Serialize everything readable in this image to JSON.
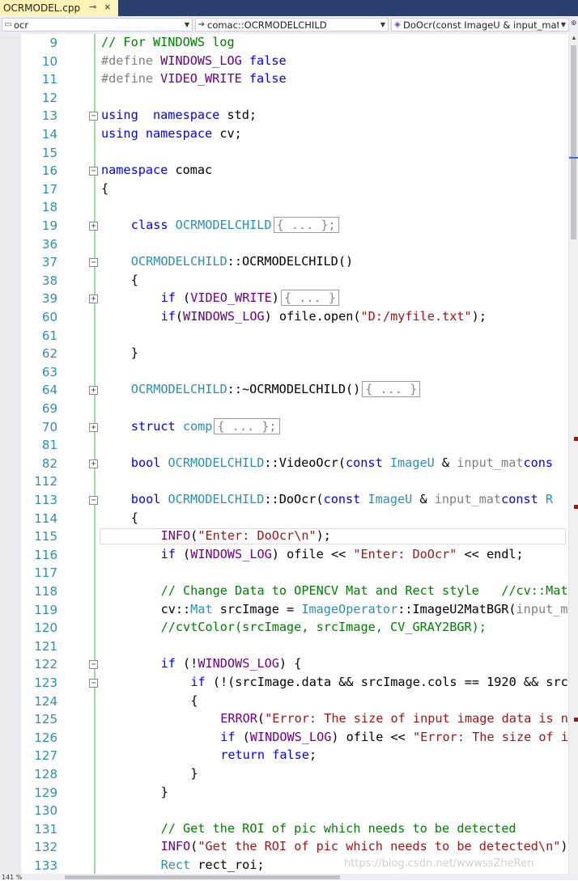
{
  "tab": {
    "title": "OCRMODEL.cpp",
    "pin": "⊸",
    "close": "×"
  },
  "navbar": {
    "scope": {
      "icon": "file-icon",
      "text": "ocr"
    },
    "class": {
      "icon": "arrow-right-icon",
      "text": "comac::OCRMODELCHILD"
    },
    "function": {
      "icon": "method-icon",
      "text": "DoOcr(const ImageU & input_mat,"
    }
  },
  "zoom": "141 %",
  "watermark": "https://blog.csdn.net/wwwssZheRen",
  "lines": [
    {
      "n": "9",
      "fold": "",
      "indent": 0,
      "tokens": [
        [
          "cm",
          "// For WINDOWS log"
        ]
      ]
    },
    {
      "n": "10",
      "fold": "",
      "indent": 0,
      "tokens": [
        [
          "pp",
          "#define "
        ],
        [
          "mac",
          "WINDOWS_LOG"
        ],
        [
          "pp",
          " "
        ],
        [
          "kw",
          "false"
        ]
      ]
    },
    {
      "n": "11",
      "fold": "",
      "indent": 0,
      "tokens": [
        [
          "pp",
          "#define "
        ],
        [
          "mac",
          "VIDEO_WRITE"
        ],
        [
          "pp",
          " "
        ],
        [
          "kw",
          "false"
        ]
      ]
    },
    {
      "n": "12",
      "fold": "",
      "indent": 0,
      "tokens": []
    },
    {
      "n": "13",
      "fold": "−",
      "indent": 0,
      "tokens": [
        [
          "kw",
          "using"
        ],
        [
          "",
          "  "
        ],
        [
          "kw",
          "namespace"
        ],
        [
          "",
          " std;"
        ]
      ]
    },
    {
      "n": "14",
      "fold": "",
      "indent": 0,
      "tokens": [
        [
          "kw",
          "using"
        ],
        [
          "",
          " "
        ],
        [
          "kw",
          "namespace"
        ],
        [
          "",
          " cv;"
        ]
      ]
    },
    {
      "n": "15",
      "fold": "",
      "indent": 0,
      "tokens": []
    },
    {
      "n": "16",
      "fold": "−",
      "indent": 0,
      "tokens": [
        [
          "kw",
          "namespace"
        ],
        [
          "",
          " comac"
        ]
      ]
    },
    {
      "n": "17",
      "fold": "",
      "indent": 0,
      "tokens": [
        [
          "",
          "{"
        ]
      ]
    },
    {
      "n": "18",
      "fold": "",
      "indent": 0,
      "tokens": []
    },
    {
      "n": "19",
      "fold": "+",
      "indent": 1,
      "tokens": [
        [
          "kw",
          "class"
        ],
        [
          "",
          " "
        ],
        [
          "cls",
          "OCRMODELCHILD"
        ],
        [
          "box",
          "{ ... };"
        ]
      ]
    },
    {
      "n": "36",
      "fold": "",
      "indent": 0,
      "tokens": []
    },
    {
      "n": "37",
      "fold": "−",
      "indent": 1,
      "tokens": [
        [
          "cls",
          "OCRMODELCHILD"
        ],
        [
          "",
          "::OCRMODELCHILD()"
        ]
      ]
    },
    {
      "n": "38",
      "fold": "",
      "indent": 1,
      "tokens": [
        [
          "",
          "{"
        ]
      ]
    },
    {
      "n": "39",
      "fold": "+",
      "indent": 2,
      "tokens": [
        [
          "kw",
          "if"
        ],
        [
          "",
          " ("
        ],
        [
          "mac",
          "VIDEO_WRITE"
        ],
        [
          "",
          ")"
        ],
        [
          "box",
          "{ ... }"
        ]
      ]
    },
    {
      "n": "60",
      "fold": "",
      "indent": 2,
      "tokens": [
        [
          "kw",
          "if"
        ],
        [
          "",
          "("
        ],
        [
          "mac",
          "WINDOWS_LOG"
        ],
        [
          "",
          ") ofile.open("
        ],
        [
          "str",
          "\"D:/myfile.txt\""
        ],
        [
          "",
          ");"
        ]
      ]
    },
    {
      "n": "61",
      "fold": "",
      "indent": 0,
      "tokens": []
    },
    {
      "n": "62",
      "fold": "",
      "indent": 1,
      "tokens": [
        [
          "",
          "}"
        ]
      ]
    },
    {
      "n": "63",
      "fold": "",
      "indent": 0,
      "tokens": []
    },
    {
      "n": "64",
      "fold": "+",
      "indent": 1,
      "tokens": [
        [
          "cls",
          "OCRMODELCHILD"
        ],
        [
          "",
          "::~OCRMODELCHILD()"
        ],
        [
          "box",
          "{ ... }"
        ]
      ]
    },
    {
      "n": "69",
      "fold": "",
      "indent": 0,
      "tokens": []
    },
    {
      "n": "70",
      "fold": "+",
      "indent": 1,
      "tokens": [
        [
          "kw",
          "struct"
        ],
        [
          "",
          " "
        ],
        [
          "cls",
          "comp"
        ],
        [
          "box",
          "{ ... };"
        ]
      ]
    },
    {
      "n": "81",
      "fold": "",
      "indent": 0,
      "tokens": []
    },
    {
      "n": "82",
      "fold": "+",
      "indent": 1,
      "tokens": [
        [
          "kw",
          "bool"
        ],
        [
          "",
          " "
        ],
        [
          "cls",
          "OCRMODELCHILD"
        ],
        [
          "",
          "::VideoOcr("
        ],
        [
          "kw",
          "const"
        ],
        [
          "",
          " "
        ],
        [
          "cls",
          "ImageU"
        ],
        [
          "",
          " & "
        ],
        [
          "var",
          "input_mat"
        ],
        [
          ", "
        ],
        [
          "kw",
          "cons"
        ]
      ]
    },
    {
      "n": "112",
      "fold": "",
      "indent": 0,
      "tokens": []
    },
    {
      "n": "113",
      "fold": "−",
      "indent": 1,
      "tokens": [
        [
          "kw",
          "bool"
        ],
        [
          "",
          " "
        ],
        [
          "cls",
          "OCRMODELCHILD"
        ],
        [
          "",
          "::DoOcr("
        ],
        [
          "kw",
          "const"
        ],
        [
          "",
          " "
        ],
        [
          "cls",
          "ImageU"
        ],
        [
          "",
          " & "
        ],
        [
          "var",
          "input_mat"
        ],
        [
          ", "
        ],
        [
          "kw",
          "const"
        ],
        [
          "",
          " "
        ],
        [
          "cls",
          "R"
        ]
      ]
    },
    {
      "n": "114",
      "fold": "",
      "indent": 1,
      "tokens": [
        [
          "",
          "{"
        ]
      ]
    },
    {
      "n": "115",
      "fold": "",
      "indent": 2,
      "current": true,
      "tokens": [
        [
          "mac",
          "INFO"
        ],
        [
          "",
          "("
        ],
        [
          "str",
          "\"Enter: DoOcr\\n\""
        ],
        [
          "",
          ");"
        ]
      ]
    },
    {
      "n": "116",
      "fold": "",
      "indent": 2,
      "tokens": [
        [
          "kw",
          "if"
        ],
        [
          "",
          " ("
        ],
        [
          "mac",
          "WINDOWS_LOG"
        ],
        [
          "",
          ") ofile "
        ],
        [
          "",
          "<< "
        ],
        [
          "str",
          "\"Enter: DoOcr\""
        ],
        [
          "",
          " << endl;"
        ]
      ]
    },
    {
      "n": "117",
      "fold": "",
      "indent": 0,
      "tokens": []
    },
    {
      "n": "118",
      "fold": "",
      "indent": 2,
      "tokens": [
        [
          "cm",
          "// Change Data to OPENCV Mat and Rect style   //cv::Mat"
        ]
      ]
    },
    {
      "n": "119",
      "fold": "",
      "indent": 2,
      "tokens": [
        [
          "",
          "cv::"
        ],
        [
          "cls",
          "Mat"
        ],
        [
          "",
          " srcImage = "
        ],
        [
          "cls",
          "ImageOperator"
        ],
        [
          "",
          "::ImageU2MatBGR("
        ],
        [
          "var",
          "input_m"
        ]
      ]
    },
    {
      "n": "120",
      "fold": "",
      "indent": 2,
      "tokens": [
        [
          "cm",
          "//cvtColor(srcImage, srcImage, CV_GRAY2BGR);"
        ]
      ]
    },
    {
      "n": "121",
      "fold": "",
      "indent": 0,
      "tokens": []
    },
    {
      "n": "122",
      "fold": "−",
      "indent": 2,
      "tokens": [
        [
          "kw",
          "if"
        ],
        [
          "",
          " (!"
        ],
        [
          "mac",
          "WINDOWS_LOG"
        ],
        [
          "",
          ") {"
        ]
      ]
    },
    {
      "n": "123",
      "fold": "−",
      "indent": 3,
      "tokens": [
        [
          "kw",
          "if"
        ],
        [
          "",
          " (!(srcImage.data && srcImage.cols == 1920 && src"
        ]
      ]
    },
    {
      "n": "124",
      "fold": "",
      "indent": 3,
      "tokens": [
        [
          "",
          "{"
        ]
      ]
    },
    {
      "n": "125",
      "fold": "",
      "indent": 4,
      "tokens": [
        [
          "mac",
          "ERROR"
        ],
        [
          "",
          "("
        ],
        [
          "str",
          "\"Error: The size of input image data is n"
        ]
      ]
    },
    {
      "n": "126",
      "fold": "",
      "indent": 4,
      "tokens": [
        [
          "kw",
          "if"
        ],
        [
          "",
          " ("
        ],
        [
          "mac",
          "WINDOWS_LOG"
        ],
        [
          "",
          ") ofile << "
        ],
        [
          "str",
          "\"Error: The size of i"
        ]
      ]
    },
    {
      "n": "127",
      "fold": "",
      "indent": 4,
      "tokens": [
        [
          "kw",
          "return"
        ],
        [
          "",
          " "
        ],
        [
          "kw",
          "false"
        ],
        [
          "",
          ";"
        ]
      ]
    },
    {
      "n": "128",
      "fold": "",
      "indent": 3,
      "tokens": [
        [
          "",
          "}"
        ]
      ]
    },
    {
      "n": "129",
      "fold": "",
      "indent": 2,
      "tokens": [
        [
          "",
          "}"
        ]
      ]
    },
    {
      "n": "130",
      "fold": "",
      "indent": 0,
      "tokens": []
    },
    {
      "n": "131",
      "fold": "",
      "indent": 2,
      "tokens": [
        [
          "cm",
          "// Get the ROI of pic which needs to be detected"
        ]
      ]
    },
    {
      "n": "132",
      "fold": "",
      "indent": 2,
      "tokens": [
        [
          "mac",
          "INFO"
        ],
        [
          "",
          "("
        ],
        [
          "str",
          "\"Get the ROI of pic which needs to be detected\\n\""
        ],
        [
          "",
          ")"
        ]
      ]
    },
    {
      "n": "133",
      "fold": "",
      "indent": 2,
      "tokens": [
        [
          "cls",
          "Rect"
        ],
        [
          "",
          " rect_roi;"
        ]
      ]
    }
  ]
}
